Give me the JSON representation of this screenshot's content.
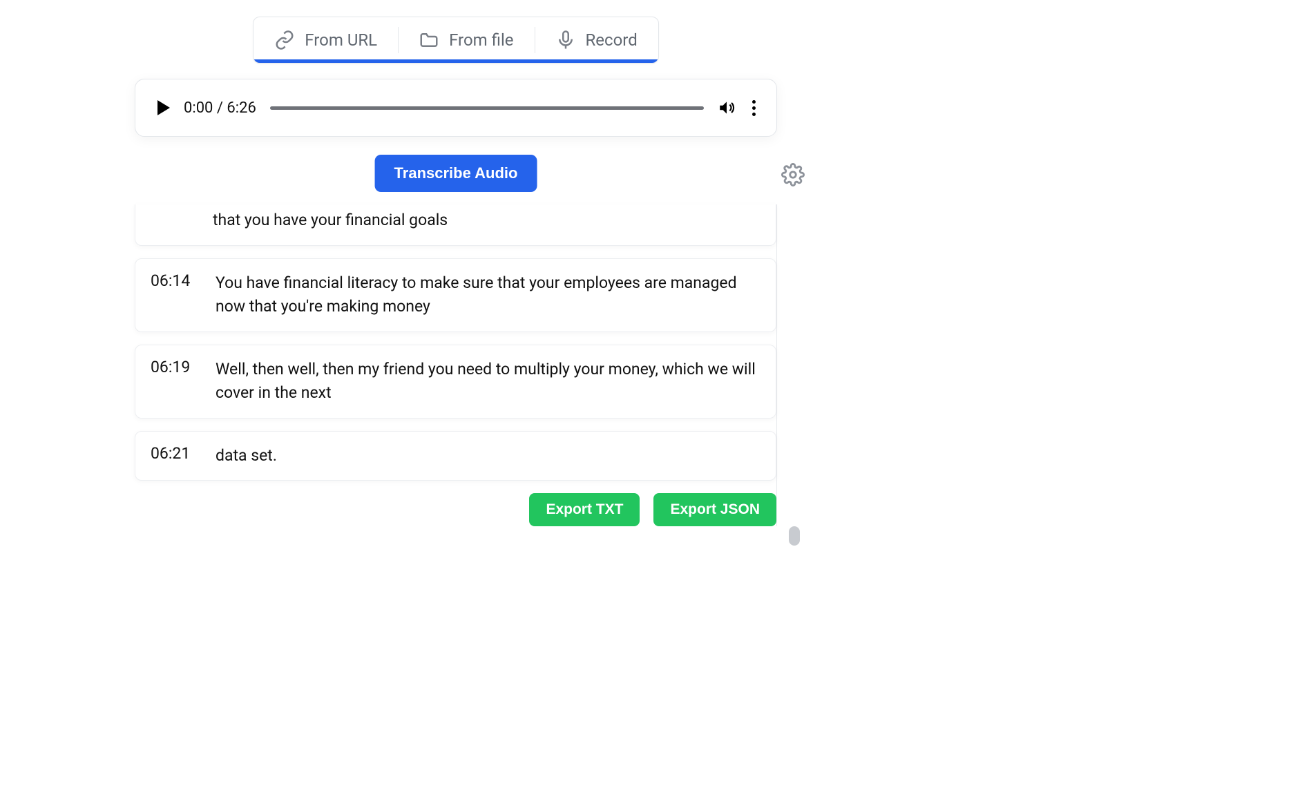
{
  "tabs": {
    "from_url": "From URL",
    "from_file": "From file",
    "record": "Record"
  },
  "player": {
    "current_time": "0:00",
    "duration": "6:26",
    "time_display": "0:00 / 6:26"
  },
  "actions": {
    "transcribe_label": "Transcribe Audio"
  },
  "transcript": {
    "segments": [
      {
        "time": "",
        "text": "that you have your financial goals"
      },
      {
        "time": "06:14",
        "text": "You have financial literacy to make sure that your employees are managed now that you're making money"
      },
      {
        "time": "06:19",
        "text": "Well, then well, then my friend you need to multiply your money, which we will cover in the next"
      },
      {
        "time": "06:21",
        "text": "data set."
      }
    ]
  },
  "export": {
    "txt_label": "Export TXT",
    "json_label": "Export JSON"
  }
}
